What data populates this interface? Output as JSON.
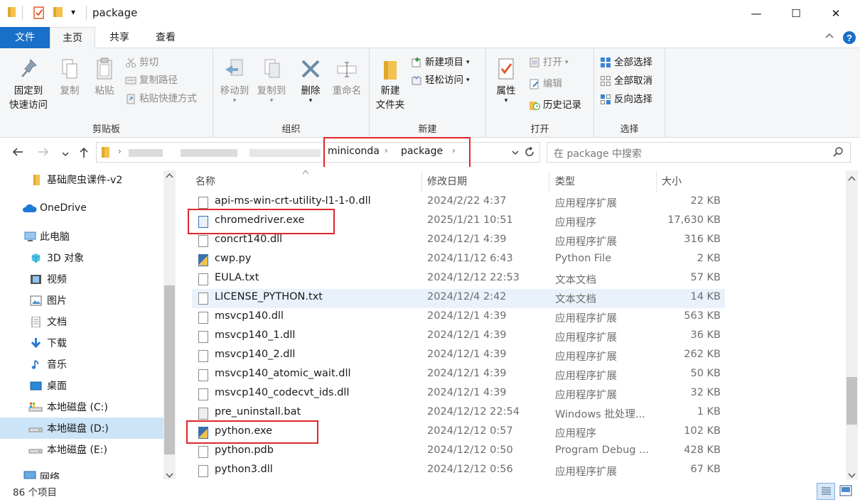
{
  "window": {
    "title": "package",
    "qa_dropdown": "▾",
    "controls": {
      "minimize": "—",
      "maximize": "☐",
      "close": "✕"
    }
  },
  "ribbon_tabs": {
    "file": "文件",
    "home": "主页",
    "share": "共享",
    "view": "查看"
  },
  "ribbon": {
    "clipboard": {
      "label": "剪贴板",
      "pin": "固定到\n快速访问",
      "copy": "复制",
      "paste": "粘贴",
      "cut": "剪切",
      "copy_path": "复制路径",
      "paste_shortcut": "粘贴快捷方式"
    },
    "organize": {
      "label": "组织",
      "move_to": "移动到",
      "copy_to": "复制到",
      "delete": "删除",
      "rename": "重命名"
    },
    "new": {
      "label": "新建",
      "new_folder": "新建\n文件夹",
      "new_item": "新建项目",
      "easy_access": "轻松访问"
    },
    "open": {
      "label": "打开",
      "properties": "属性",
      "open": "打开",
      "edit": "编辑",
      "history": "历史记录"
    },
    "select": {
      "label": "选择",
      "select_all": "全部选择",
      "select_none": "全部取消",
      "invert": "反向选择"
    }
  },
  "address": {
    "crumbs": [
      "miniconda",
      "package"
    ],
    "search_placeholder": "在 package 中搜索"
  },
  "nav": [
    {
      "label": "基础爬虫课件-v2",
      "icon": "folder-icon"
    },
    {
      "label": "OneDrive",
      "icon": "cloud-icon"
    },
    {
      "label": "此电脑",
      "icon": "computer-icon"
    },
    {
      "label": "3D 对象",
      "icon": "3d-objects-icon"
    },
    {
      "label": "视频",
      "icon": "video-icon"
    },
    {
      "label": "图片",
      "icon": "pictures-icon"
    },
    {
      "label": "文档",
      "icon": "documents-icon"
    },
    {
      "label": "下载",
      "icon": "download-icon"
    },
    {
      "label": "音乐",
      "icon": "music-icon"
    },
    {
      "label": "桌面",
      "icon": "desktop-icon"
    },
    {
      "label": "本地磁盘 (C:)",
      "icon": "drive-c-icon"
    },
    {
      "label": "本地磁盘 (D:)",
      "icon": "drive-icon"
    },
    {
      "label": "本地磁盘 (E:)",
      "icon": "drive-icon"
    },
    {
      "label": "网络",
      "icon": "network-icon"
    }
  ],
  "columns": {
    "name": "名称",
    "date": "修改日期",
    "type": "类型",
    "size": "大小"
  },
  "files": [
    {
      "name": "api-ms-win-crt-utility-l1-1-0.dll",
      "date": "2024/2/22 4:37",
      "type": "应用程序扩展",
      "size": "22 KB"
    },
    {
      "name": "chromedriver.exe",
      "date": "2025/1/21 10:51",
      "type": "应用程序",
      "size": "17,630 KB"
    },
    {
      "name": "concrt140.dll",
      "date": "2024/12/1 4:39",
      "type": "应用程序扩展",
      "size": "316 KB"
    },
    {
      "name": "cwp.py",
      "date": "2024/11/12 6:43",
      "type": "Python File",
      "size": "2 KB"
    },
    {
      "name": "EULA.txt",
      "date": "2024/12/12 22:53",
      "type": "文本文档",
      "size": "57 KB"
    },
    {
      "name": "LICENSE_PYTHON.txt",
      "date": "2024/12/4 2:42",
      "type": "文本文档",
      "size": "14 KB"
    },
    {
      "name": "msvcp140.dll",
      "date": "2024/12/1 4:39",
      "type": "应用程序扩展",
      "size": "563 KB"
    },
    {
      "name": "msvcp140_1.dll",
      "date": "2024/12/1 4:39",
      "type": "应用程序扩展",
      "size": "36 KB"
    },
    {
      "name": "msvcp140_2.dll",
      "date": "2024/12/1 4:39",
      "type": "应用程序扩展",
      "size": "262 KB"
    },
    {
      "name": "msvcp140_atomic_wait.dll",
      "date": "2024/12/1 4:39",
      "type": "应用程序扩展",
      "size": "50 KB"
    },
    {
      "name": "msvcp140_codecvt_ids.dll",
      "date": "2024/12/1 4:39",
      "type": "应用程序扩展",
      "size": "32 KB"
    },
    {
      "name": "pre_uninstall.bat",
      "date": "2024/12/12 22:54",
      "type": "Windows 批处理...",
      "size": "1 KB"
    },
    {
      "name": "python.exe",
      "date": "2024/12/12 0:57",
      "type": "应用程序",
      "size": "102 KB"
    },
    {
      "name": "python.pdb",
      "date": "2024/12/12 0:50",
      "type": "Program Debug ...",
      "size": "428 KB"
    },
    {
      "name": "python3.dll",
      "date": "2024/12/12 0:56",
      "type": "应用程序扩展",
      "size": "67 KB"
    }
  ],
  "status": {
    "count": "86 个项目"
  }
}
